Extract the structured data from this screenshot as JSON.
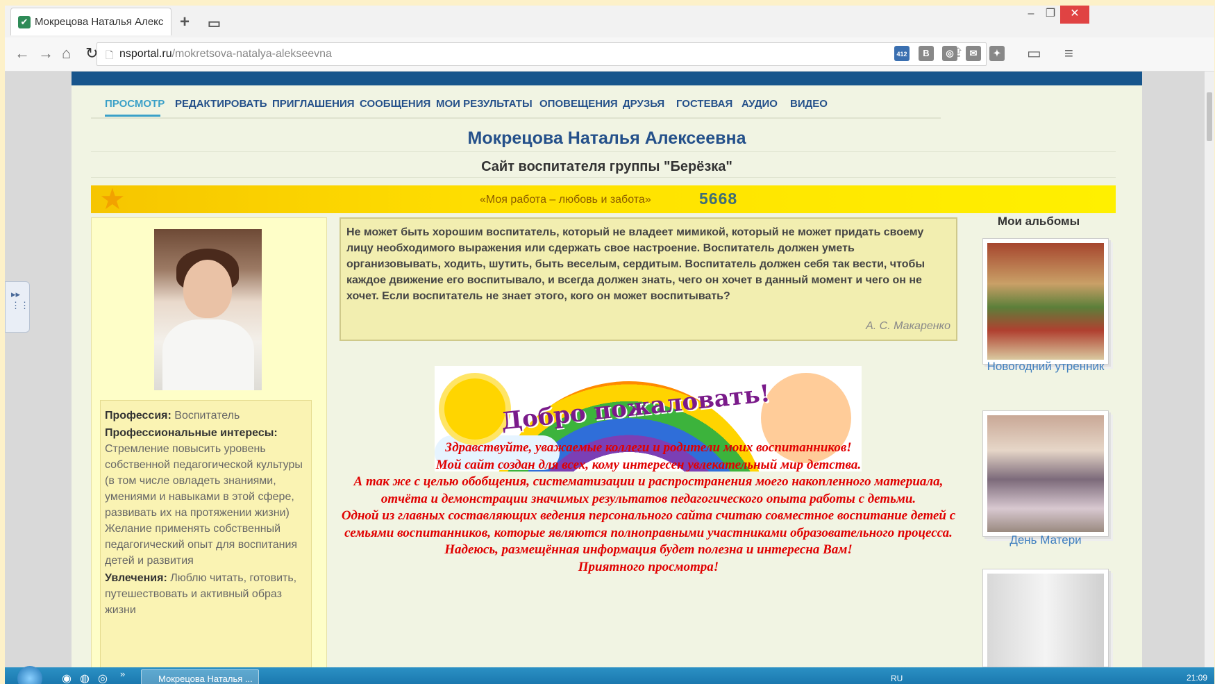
{
  "browser": {
    "tab_title": "Мокрецова Наталья Алекс",
    "url_host": "nsportal.ru",
    "url_path": "/mokretsova-natalya-alekseevna",
    "badge_count": "412"
  },
  "nav": {
    "items": [
      "ПРОСМОТР",
      "РЕДАКТИРОВАТЬ",
      "ПРИГЛАШЕНИЯ",
      "СООБЩЕНИЯ",
      "МОИ РЕЗУЛЬТАТЫ",
      "ОПОВЕЩЕНИЯ",
      "ДРУЗЬЯ",
      "ГОСТЕВАЯ",
      "АУДИО",
      "ВИДЕО"
    ],
    "active": "ПРОСМОТР"
  },
  "header": {
    "name": "Мокрецова Наталья Алексеевна",
    "subtitle": "Сайт воспитателя группы \"Берёзка\"",
    "motto": "«Моя работа – любовь и забота»",
    "counter": "5668"
  },
  "profile": {
    "profession_label": "Профессия:",
    "profession_value": "Воспитатель",
    "interests_label": "Профессиональные интересы:",
    "interests_value": "Стремление повысить уровень собственной педагогической культуры (в том числе овладеть знаниями, умениями и навыками в этой сфере, развивать их на протяжении жизни) Желание применять собственный педагогический опыт для воспитания детей и развития",
    "hobbies_label": "Увлечения:",
    "hobbies_value": "Люблю читать, готовить, путешествовать и активный образ жизни"
  },
  "quote": {
    "text": "Не может быть хорошим воспитатель, который не владеет мимикой, который не может придать своему лицу необходимого выражения или сдержать свое настроение. Воспитатель должен уметь организовывать, ходить, шутить, быть веселым, сердитым. Воспитатель должен себя так вести, чтобы каждое движение его воспитывало, и всегда должен знать, чего он хочет в данный момент и чего он не хочет. Если воспитатель не знает этого, кого он может воспитывать?",
    "author": "А. С. Макаренко"
  },
  "welcome_image_text": "Добро пожаловать!",
  "greeting": [
    "Здравствуйте, уважаемые коллеги и родители моих воспитанников!",
    "Мой сайт создан для всех, кому интересен увлекательный мир детства.",
    "А так же с целью обобщения, систематизации и распространения моего накопленного материала, отчёта и демонстрации значимых результатов педагогического опыта работы с детьми.",
    "Одной из главных составляющих ведения персонального сайта считаю совместное воспитание детей с семьями воспитанников, которые являются полноправными участниками образовательного процесса.",
    "Надеюсь, размещённая информация будет полезна и интересна Вам!",
    "Приятного просмотра!"
  ],
  "albums": {
    "title": "Мои альбомы",
    "items": [
      {
        "label": "Новогодний утренник"
      },
      {
        "label": "День Матери"
      }
    ]
  },
  "taskbar": {
    "window_label": "Мокрецова Наталья ...",
    "lang": "RU",
    "clock": "21:09"
  },
  "colors": {
    "accent_nav": "#24508a",
    "active_nav": "#3aa0c8",
    "banner": "#ffe000",
    "greeting_red": "#e00000"
  }
}
